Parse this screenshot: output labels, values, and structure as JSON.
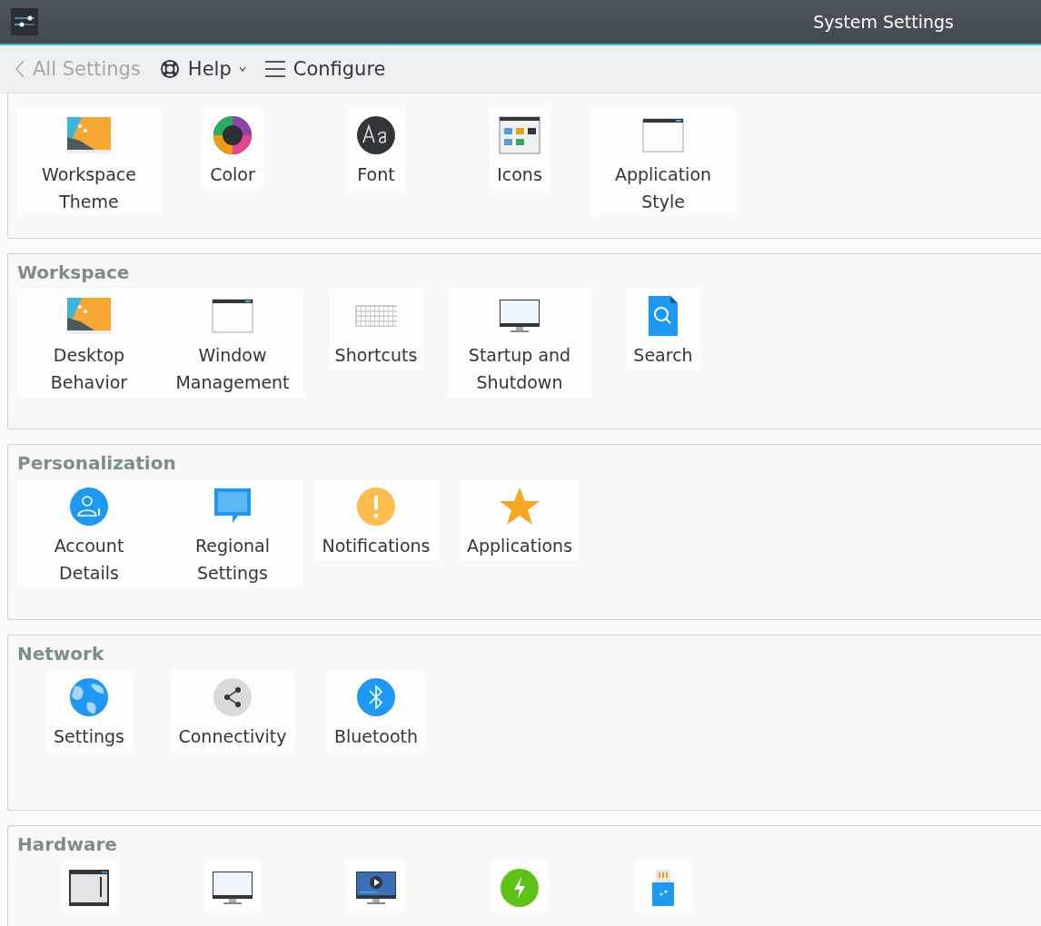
{
  "window": {
    "title": "System Settings"
  },
  "toolbar": {
    "back": {
      "label": "All Settings",
      "disabled": true
    },
    "help": {
      "label": "Help"
    },
    "configure": {
      "label": "Configure"
    }
  },
  "sections": [
    {
      "title_visible": false,
      "items": [
        {
          "label": "Workspace Theme"
        },
        {
          "label": "Color"
        },
        {
          "label": "Font"
        },
        {
          "label": "Icons"
        },
        {
          "label": "Application Style"
        }
      ]
    },
    {
      "title": "Workspace",
      "items": [
        {
          "label": "Desktop Behavior"
        },
        {
          "label": "Window Management"
        },
        {
          "label": "Shortcuts"
        },
        {
          "label": "Startup and Shutdown"
        },
        {
          "label": "Search"
        }
      ]
    },
    {
      "title": "Personalization",
      "items": [
        {
          "label": "Account Details"
        },
        {
          "label": "Regional Settings"
        },
        {
          "label": "Notifications"
        },
        {
          "label": "Applications"
        }
      ]
    },
    {
      "title": "Network",
      "items": [
        {
          "label": "Settings"
        },
        {
          "label": "Connectivity"
        },
        {
          "label": "Bluetooth"
        }
      ]
    },
    {
      "title": "Hardware",
      "items": [
        {
          "label_visible": false
        },
        {
          "label_visible": false
        },
        {
          "label_visible": false
        },
        {
          "label_visible": false
        },
        {
          "label_visible": false
        }
      ]
    }
  ]
}
